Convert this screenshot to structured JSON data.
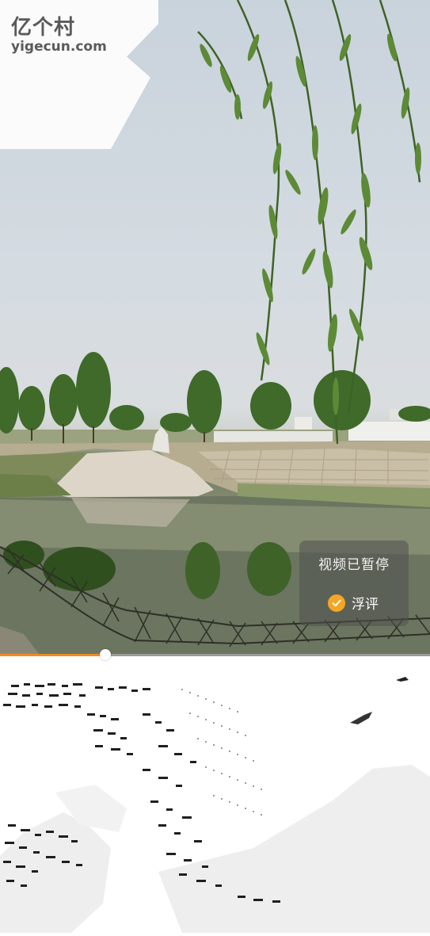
{
  "watermark": {
    "logo_cn": "亿个村",
    "logo_en": "yigecun.com"
  },
  "player": {
    "paused_text": "视频已暂停",
    "float_label": "浮评",
    "float_enabled": true,
    "progress_fraction": 0.245
  },
  "colors": {
    "accent": "#f08a24",
    "check": "#f5a623"
  }
}
